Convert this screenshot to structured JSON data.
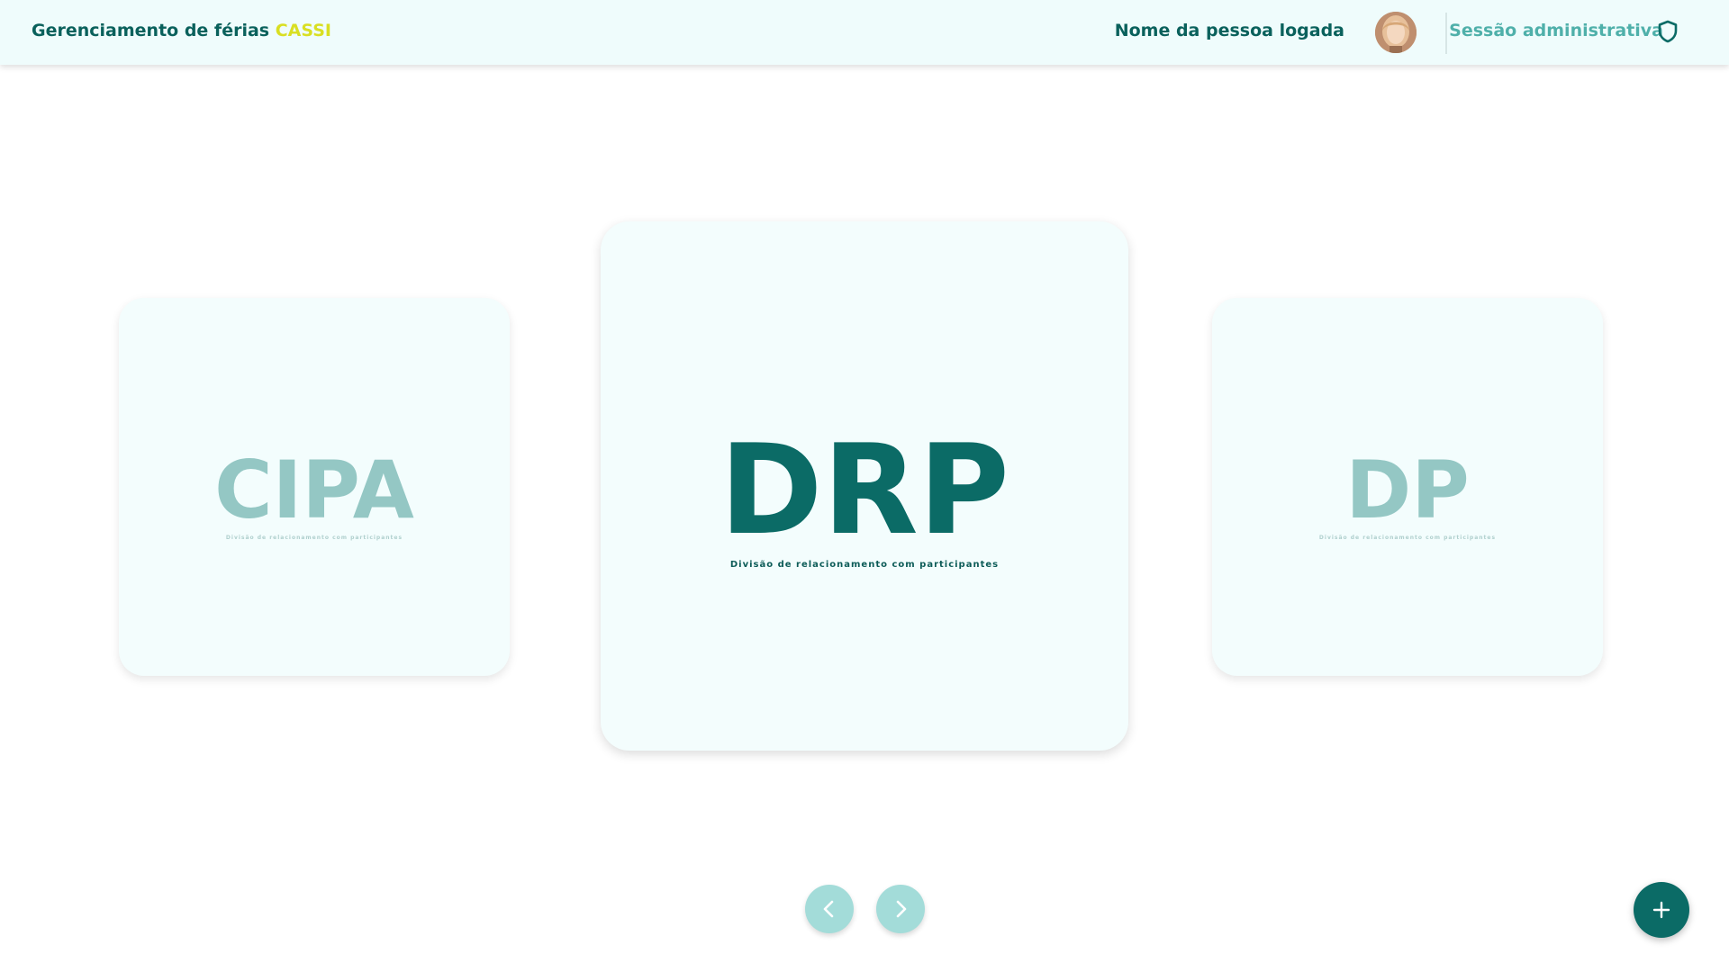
{
  "header": {
    "title": "Gerenciamento de férias",
    "brand": "CASSI",
    "user_name": "Nome da pessoa logada",
    "session_label": "Sessão administrativa"
  },
  "icons": {
    "shield": "shield-icon",
    "prev": "chevron-left-icon",
    "next": "chevron-right-icon",
    "add": "plus-icon"
  },
  "cards": {
    "left": {
      "code": "CIPA",
      "description": "Divisão de relacionamento com participantes"
    },
    "center": {
      "code": "DRP",
      "description": "Divisão de relacionamento com participantes"
    },
    "right": {
      "code": "DP",
      "description": "Divisão de relacionamento com participantes"
    }
  },
  "colors": {
    "primary": "#0b6b66",
    "brand_accent": "#d9df22",
    "secondary": "#4fb0aa",
    "nav_button": "#a3dcd9",
    "card_background": "#f3fdfd",
    "header_background": "#effcfc"
  }
}
